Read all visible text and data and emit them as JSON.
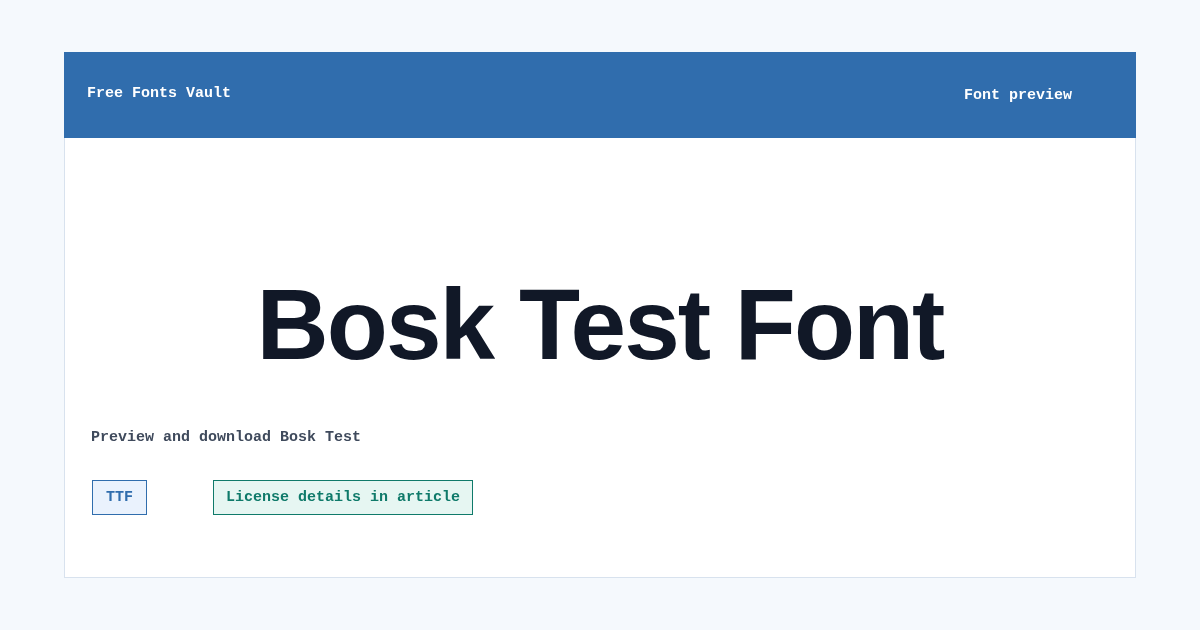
{
  "header": {
    "site_name": "Free Fonts Vault",
    "page_label": "Font preview"
  },
  "preview": {
    "sample_text": "Bosk Test Font",
    "description": "Preview and download Bosk Test"
  },
  "tags": [
    {
      "kind": "format",
      "label": "TTF"
    },
    {
      "kind": "license",
      "label": "License details in article"
    }
  ]
}
